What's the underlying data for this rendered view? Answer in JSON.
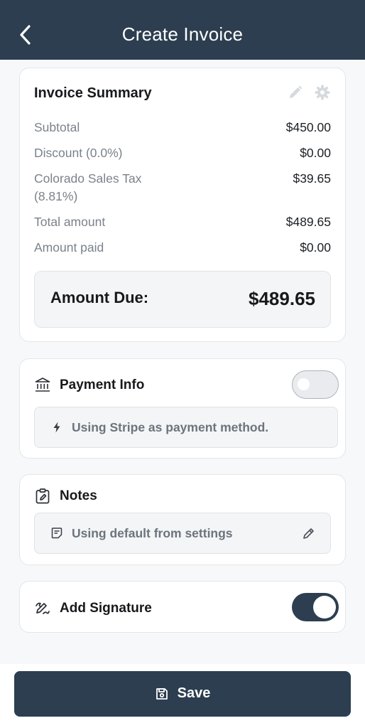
{
  "header": {
    "title": "Create Invoice"
  },
  "summary": {
    "title": "Invoice Summary",
    "rows": [
      {
        "label": "Subtotal",
        "value": "$450.00"
      },
      {
        "label": "Discount (0.0%)",
        "value": "$0.00"
      },
      {
        "label": "Colorado Sales Tax",
        "label_line2": "(8.81%)",
        "value": "$39.65"
      },
      {
        "label": "Total amount",
        "value": "$489.65"
      },
      {
        "label": "Amount paid",
        "value": "$0.00"
      }
    ],
    "due_label": "Amount Due:",
    "due_value": "$489.65"
  },
  "payment": {
    "title": "Payment Info",
    "enabled": false,
    "method_text": "Using Stripe as payment method."
  },
  "notes": {
    "title": "Notes",
    "text": "Using default from settings"
  },
  "signature": {
    "title": "Add Signature",
    "enabled": true
  },
  "footer": {
    "save_label": "Save"
  },
  "colors": {
    "header_bg": "#2c3e50",
    "primary": "#2c3e50",
    "muted_text": "#7b828b",
    "toggle_off": "#e9ebee"
  },
  "icons": [
    "back-arrow-icon",
    "pencil-icon",
    "gear-icon",
    "bank-icon",
    "bolt-icon",
    "clipboard-edit-icon",
    "note-icon",
    "signature-icon",
    "floppy-disk-icon"
  ]
}
